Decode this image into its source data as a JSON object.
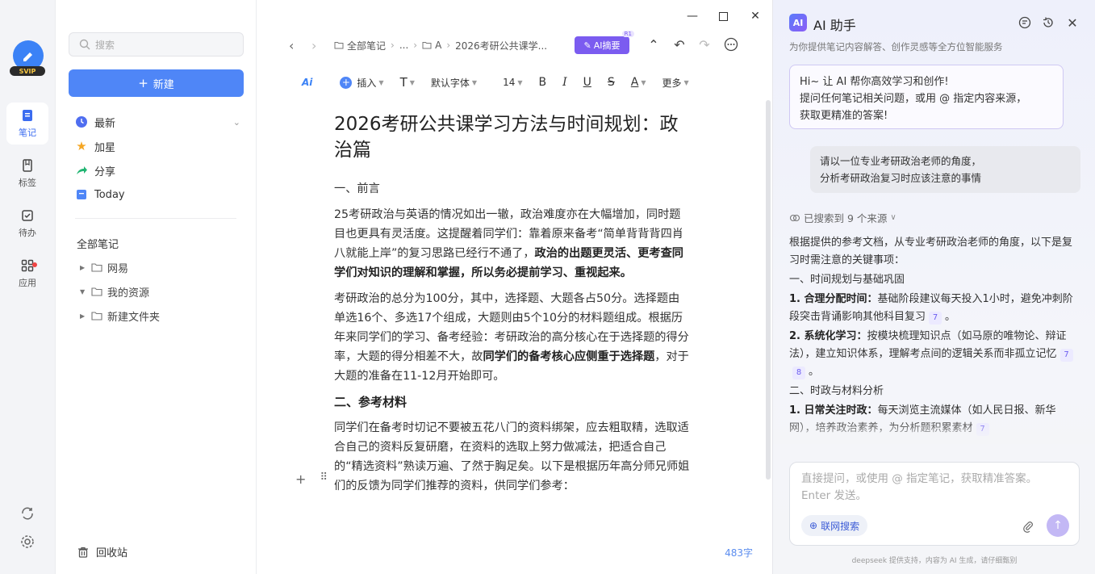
{
  "rail": {
    "svip": "SVIP",
    "items": [
      {
        "label": "笔记",
        "icon": "note-icon"
      },
      {
        "label": "标签",
        "icon": "bookmark-icon"
      },
      {
        "label": "待办",
        "icon": "todo-icon"
      },
      {
        "label": "应用",
        "icon": "apps-icon"
      }
    ]
  },
  "sidebar": {
    "search_placeholder": "搜索",
    "new_button": "新建",
    "nav": [
      {
        "label": "最新",
        "icon": "clock-icon"
      },
      {
        "label": "加星",
        "icon": "star-icon"
      },
      {
        "label": "分享",
        "icon": "share-icon"
      },
      {
        "label": "Today",
        "icon": "notebook-icon"
      }
    ],
    "section_title": "全部笔记",
    "folders": [
      {
        "label": "网易",
        "expanded": false
      },
      {
        "label": "我的资源",
        "expanded": true
      },
      {
        "label": "新建文件夹",
        "expanded": false
      }
    ],
    "recycle": "回收站"
  },
  "editor": {
    "breadcrumb": {
      "root": "全部笔记",
      "ellipsis": "...",
      "mid": "A",
      "current": "2026考研公共课学..."
    },
    "ai_summary": "AI摘要",
    "ai_summary_badge": "R1",
    "toolbar": {
      "ai": "Ai",
      "insert": "插入",
      "text_style": "T",
      "font": "默认字体",
      "size": "14",
      "bold": "B",
      "italic": "I",
      "underline": "U",
      "strike": "S",
      "color": "A",
      "more": "更多"
    },
    "title": "2026考研公共课学习方法与时间规划：政治篇",
    "section1": "一、前言",
    "p1_a": "25考研政治与英语的情况如出一辙，政治难度亦在大幅增加，同时题目也更具有灵活度。这提醒着同学们：靠着原来备考“简单背背背四肖八就能上岸”的复习思路已经行不通了，",
    "p1_b": "政治的出题更灵活、更考查同学们对知识的理解和掌握，所以务必提前学习、重视起来。",
    "p2_a": "考研政治的总分为100分，其中，选择题、大题各占50分。选择题由单选16个、多选17个组成，大题则由5个10分的材料题组成。根据历年来同学们的学习、备考经验：考研政治的高分核心在于选择题的得分率，大题的得分相差不大，故",
    "p2_b": "同学们的备考核心应侧重于选择题",
    "p2_c": "，对于大题的准备在11-12月开始即可。",
    "section2": "二、参考材料",
    "p3": "同学们在备考时切记不要被五花八门的资料绑架，应去粗取精，选取适合自己的资料反复研磨，在资料的选取上努力做减法，把适合自己的“精选资料”熟读万遍、了然于胸足矣。以下是根据历年高分师兄师姐们的反馈为同学们推荐的资料，供同学们参考：",
    "word_count": "483字"
  },
  "ai_panel": {
    "logo": "AI",
    "title": "AI 助手",
    "subtitle": "为你提供笔记内容解答、创作灵感等全方位智能服务",
    "welcome": [
      "Hi~ 让 AI 帮你高效学习和创作!",
      "提问任何笔记相关问题，或用 @ 指定内容来源，",
      "获取更精准的答案!"
    ],
    "user_msg": [
      "请以一位专业考研政治老师的角度，",
      "分析考研政治复习时应该注意的事情"
    ],
    "sources": "已搜索到 9 个来源",
    "answer": {
      "intro": "根据提供的参考文档，从专业考研政治老师的角度，以下是复习时需注意的关键事项：",
      "h1": "一、时间规划与基础巩固",
      "i1_label": "1. 合理分配时间：",
      "i1_text": "基础阶段建议每天投入1小时，避免冲刺阶段突击背诵影响其他科目复习",
      "i1_cite": "7",
      "i2_label": "2. 系统化学习：",
      "i2_text": "按模块梳理知识点（如马原的唯物论、辩证法），建立知识体系，理解考点间的逻辑关系而非孤立记忆",
      "i2_cite1": "7",
      "i2_cite2": "8",
      "h2": "二、时政与材料分析",
      "i3_label": "1. 日常关注时政：",
      "i3_text": "每天浏览主流媒体（如人民日报、新华网），培养政治素养，为分析题积累素材",
      "i3_cite": "7"
    },
    "input_placeholder": "直接提问，或使用 @ 指定笔记，获取精准答案。Enter 发送。",
    "web_search": "联网搜索",
    "footer": "deepseek 提供支持，内容为 AI 生成，请仔细甄别"
  },
  "colors": {
    "primary": "#4f86f7",
    "ai_purple": "#7b5cf0"
  }
}
